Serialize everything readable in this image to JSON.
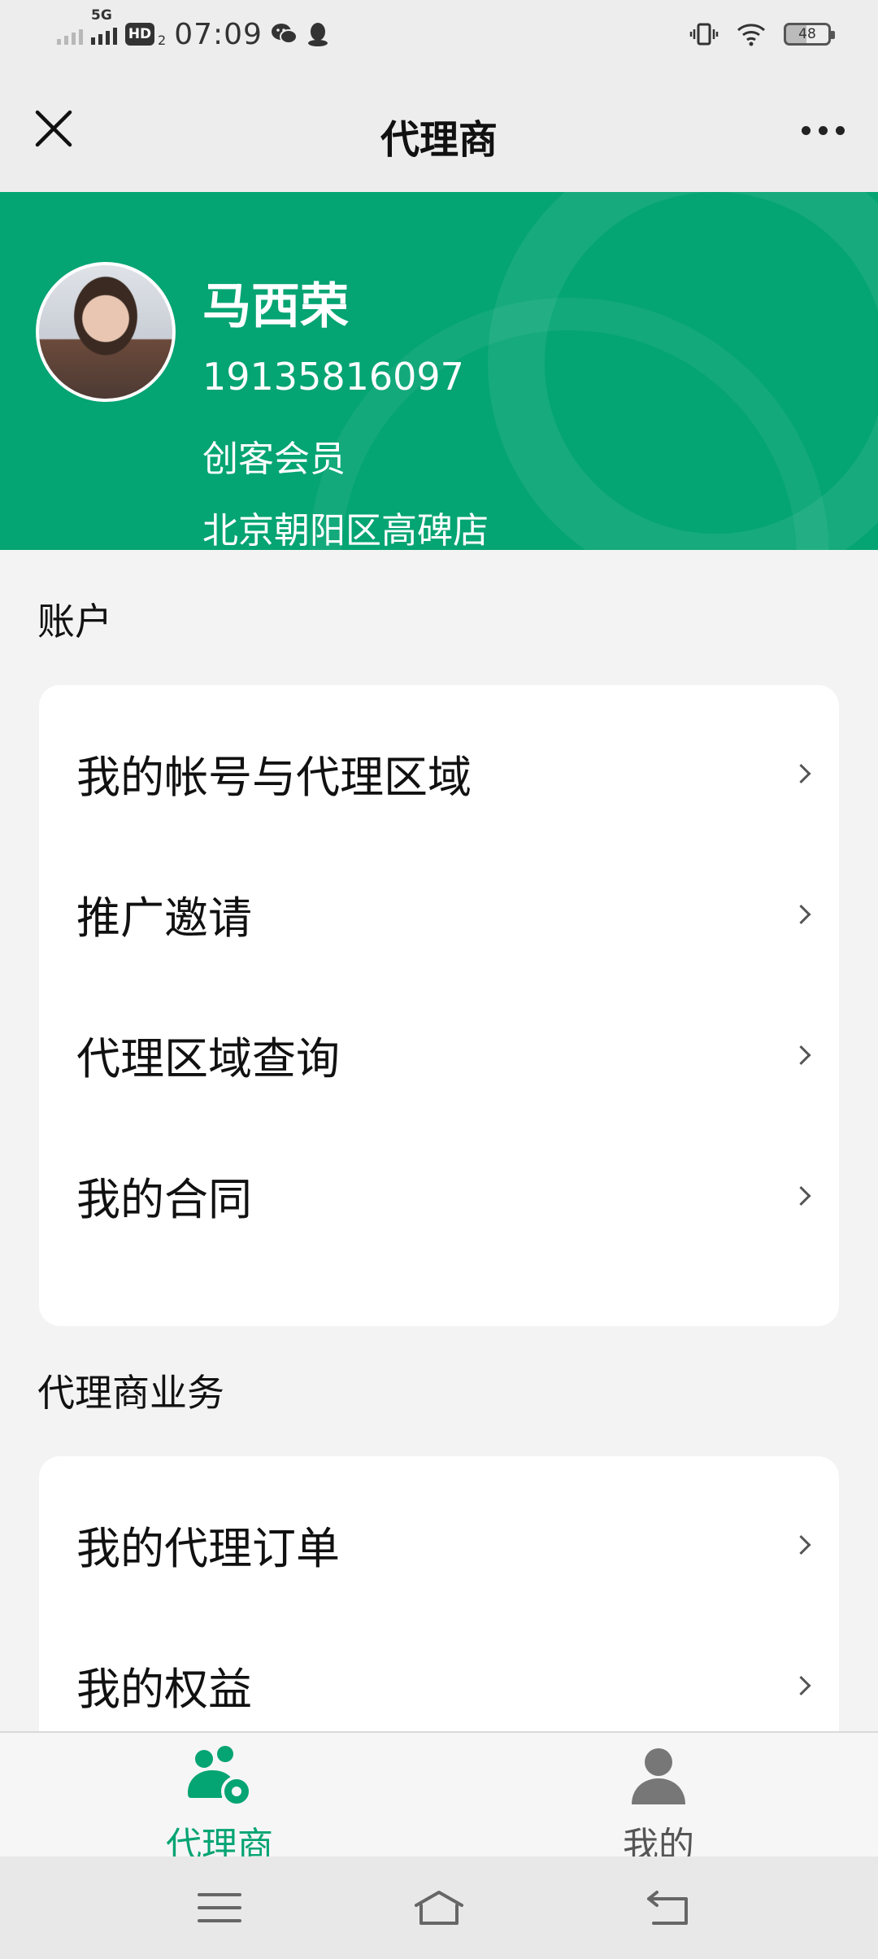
{
  "status_bar": {
    "network_type": "5G",
    "hd_label": "HD",
    "hd_sub": "2",
    "time": "07:09",
    "battery": "48"
  },
  "titlebar": {
    "title": "代理商"
  },
  "profile": {
    "name": "马西荣",
    "phone": "19135816097",
    "level": "创客会员",
    "store": "北京朝阳区高碑店"
  },
  "sections": {
    "account": {
      "title": "账户",
      "items": [
        "我的帐号与代理区域",
        "推广邀请",
        "代理区域查询",
        "我的合同"
      ]
    },
    "business": {
      "title": "代理商业务",
      "items": [
        "我的代理订单",
        "我的权益"
      ]
    }
  },
  "tabbar": {
    "tabs": [
      {
        "label": "代理商",
        "icon": "agent-icon",
        "active": true
      },
      {
        "label": "我的",
        "icon": "user-icon",
        "active": false
      }
    ]
  },
  "colors": {
    "brand": "#05a473",
    "background": "#f3f3f3"
  }
}
